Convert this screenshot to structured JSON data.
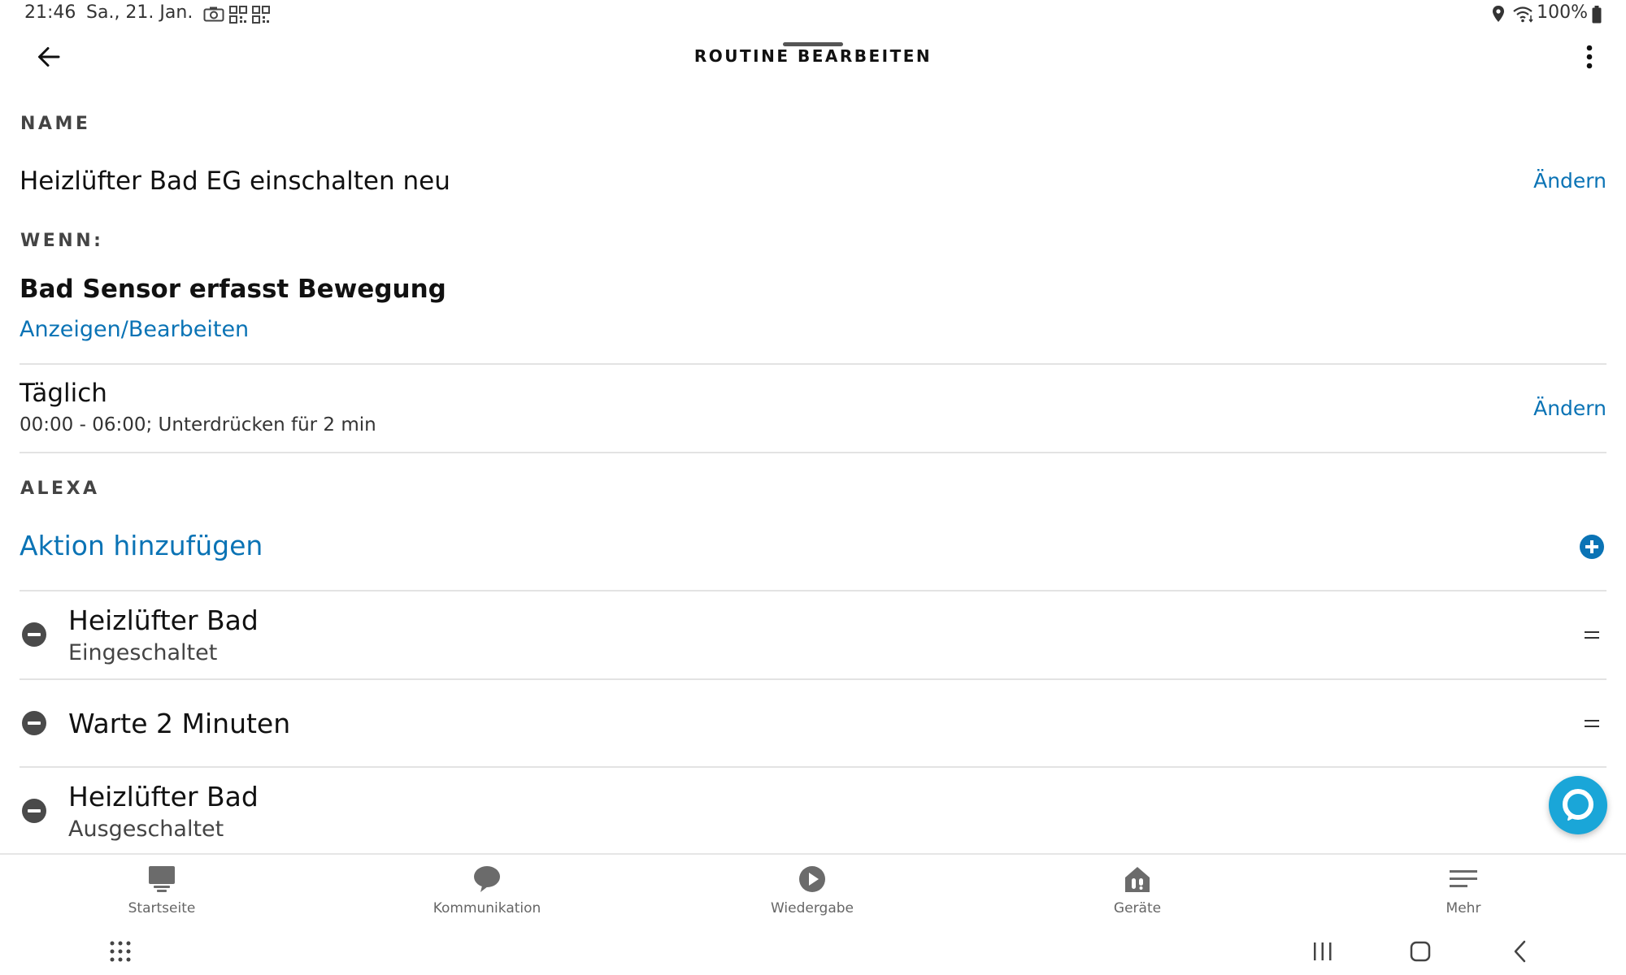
{
  "status_bar": {
    "time": "21:46",
    "date": "Sa., 21. Jan.",
    "battery": "100%",
    "icons": [
      "camera-icon",
      "qr-code-icon",
      "qr-code-icon",
      "location-icon",
      "wifi-icon",
      "battery-icon"
    ]
  },
  "header": {
    "title": "ROUTINE BEARBEITEN",
    "back_icon": "arrow-left-icon",
    "more_icon": "more-vertical-icon"
  },
  "name_section": {
    "label": "NAME",
    "value": "Heizlüfter Bad EG einschalten neu",
    "change_label": "Ändern"
  },
  "when_section": {
    "label": "WENN:",
    "trigger": "Bad Sensor erfasst Bewegung",
    "view_edit_label": "Anzeigen/Bearbeiten",
    "schedule_title": "Täglich",
    "schedule_detail": "00:00 - 06:00; Unterdrücken für 2 min",
    "change_label": "Ändern"
  },
  "alexa_section": {
    "label": "ALEXA",
    "add_action_label": "Aktion hinzufügen",
    "actions": [
      {
        "title": "Heizlüfter Bad",
        "subtitle": "Eingeschaltet"
      },
      {
        "title": "Warte 2 Minuten"
      },
      {
        "title": "Heizlüfter Bad",
        "subtitle": "Ausgeschaltet"
      }
    ]
  },
  "bottom_nav": {
    "items": [
      {
        "label": "Startseite",
        "icon": "home-icon"
      },
      {
        "label": "Kommunikation",
        "icon": "chat-icon"
      },
      {
        "label": "Wiedergabe",
        "icon": "play-icon"
      },
      {
        "label": "Geräte",
        "icon": "devices-icon"
      },
      {
        "label": "Mehr",
        "icon": "menu-icon"
      }
    ]
  },
  "colors": {
    "link": "#0a73b5",
    "alexa_button": "#1aa6d8",
    "text": "#111111",
    "divider": "#e3e3e3"
  }
}
